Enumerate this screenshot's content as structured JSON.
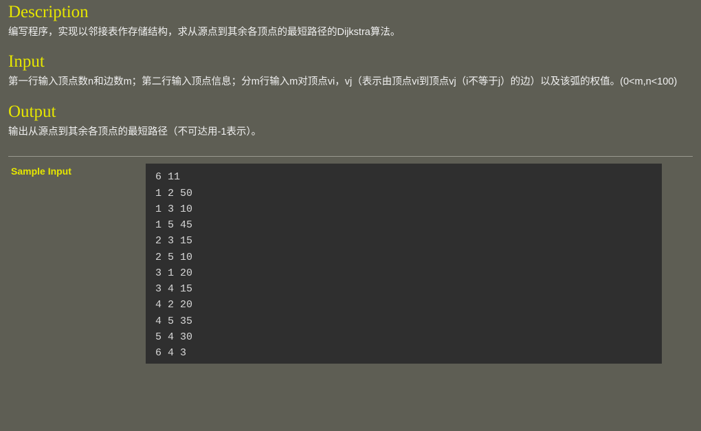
{
  "description": {
    "heading": "Description",
    "text": "编写程序，实现以邻接表作存储结构，求从源点到其余各顶点的最短路径的Dijkstra算法。"
  },
  "input": {
    "heading": "Input",
    "text": "第一行输入顶点数n和边数m；第二行输入顶点信息；分m行输入m对顶点vi，vj（表示由顶点vi到顶点vj（i不等于j）的边）以及该弧的权值。(0<m,n<100)"
  },
  "output": {
    "heading": "Output",
    "text": "输出从源点到其余各顶点的最短路径（不可达用-1表示）。"
  },
  "sample": {
    "label": "Sample Input",
    "content": "6 11\n1 2 50\n1 3 10\n1 5 45\n2 3 15\n2 5 10\n3 1 20\n3 4 15\n4 2 20\n4 5 35\n5 4 30\n6 4 3"
  }
}
